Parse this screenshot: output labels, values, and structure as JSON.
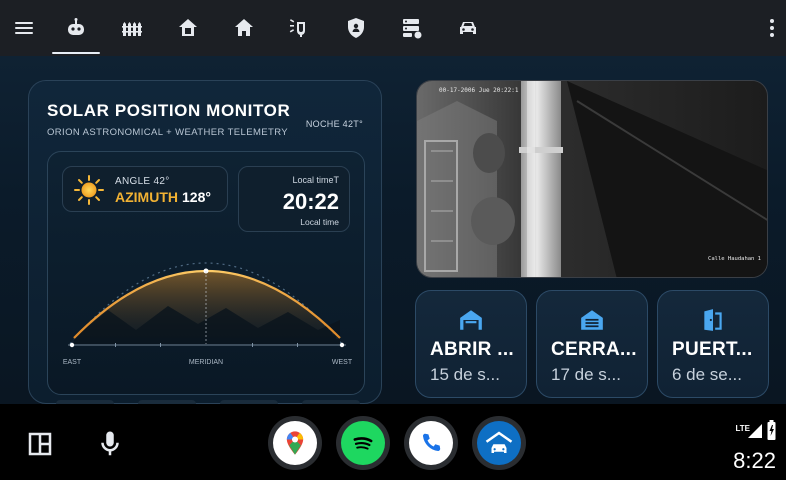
{
  "topbar": {
    "tabs": [
      {
        "icon": "robot-icon",
        "active": true
      },
      {
        "icon": "fence-icon"
      },
      {
        "icon": "house-icon"
      },
      {
        "icon": "house-filled-icon"
      },
      {
        "icon": "security-light-icon"
      },
      {
        "icon": "shield-icon"
      },
      {
        "icon": "server-icon"
      },
      {
        "icon": "car-icon"
      }
    ],
    "menu_icon": "hamburger-menu-icon",
    "overflow_icon": "more-vert-icon"
  },
  "solar": {
    "title": "SOLAR POSITION MONITOR",
    "subtitle": "ORION ASTRONOMICAL + WEATHER TELEMETRY",
    "noche": "NOCHE 42T°",
    "angle_label": "ANGLE 42°",
    "azimuth_key": "AZIMUTH",
    "azimuth_value": "128°",
    "local_time_label": "Local timeT",
    "time": "20:22",
    "local_time_caption": "Local time",
    "axis": {
      "east": "EAST",
      "mid": "MERIDIAN",
      "west": "WEST"
    }
  },
  "camera": {
    "timestamp": "00-17-2006 Jue 20:22:1",
    "name": "Calle Haudahan 1"
  },
  "tiles": [
    {
      "title": "ABRIR ...",
      "subtitle": "15 de s...",
      "icon": "garage-open-icon"
    },
    {
      "title": "CERRA...",
      "subtitle": "17 de s...",
      "icon": "garage-closed-icon"
    },
    {
      "title": "PUERT...",
      "subtitle": "6 de se...",
      "icon": "door-icon"
    }
  ],
  "bottombar": {
    "apps": [
      "google-maps-icon",
      "spotify-icon",
      "phone-icon",
      "home-garage-icon"
    ],
    "network": "LTE",
    "time": "8:22"
  },
  "colors": {
    "accent_orange": "#f2a93b",
    "tile_icon_blue": "#4aa7f0",
    "spotify_green": "#1ed760",
    "phone_blue": "#1a73e8"
  }
}
